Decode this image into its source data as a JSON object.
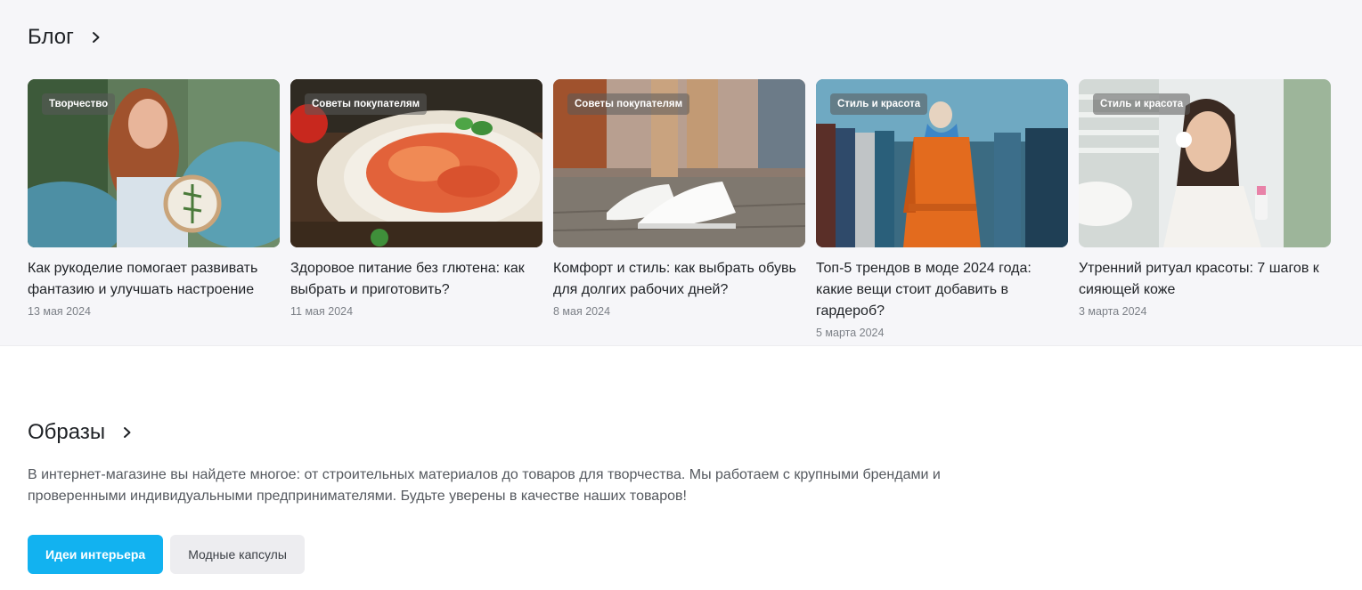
{
  "blog": {
    "title": "Блог",
    "posts": [
      {
        "tag": "Творчество",
        "title": "Как рукоделие помогает развивать фантазию и улучшать настроение",
        "date": "13 мая 2024"
      },
      {
        "tag": "Советы покупателям",
        "title": "Здоровое питание без глютена: как выбрать и приготовить?",
        "date": "11 мая 2024"
      },
      {
        "tag": "Советы покупателям",
        "title": "Комфорт и стиль: как выбрать обувь для долгих рабочих дней?",
        "date": "8 мая 2024"
      },
      {
        "tag": "Стиль и красота",
        "title": "Топ-5 трендов в моде 2024 года: какие вещи стоит добавить в гардероб?",
        "date": "5 марта 2024"
      },
      {
        "tag": "Стиль и красота",
        "title": "Утренний ритуал красоты: 7 шагов к сияющей коже",
        "date": "3 марта 2024"
      }
    ]
  },
  "looks": {
    "title": "Образы",
    "description": "В интернет-магазине вы найдете многое: от строительных материалов до товаров для творчества. Мы работаем с крупными брендами и проверенными индивидуальными предпринимателями. Будьте уверены в качестве наших товаров!",
    "tabs": [
      {
        "label": "Идеи интерьера",
        "active": true
      },
      {
        "label": "Модные капсулы",
        "active": false
      }
    ]
  },
  "colors": {
    "accent": "#12b2f0",
    "section_bg": "#f6f6f9",
    "date_text": "#7c8087"
  }
}
